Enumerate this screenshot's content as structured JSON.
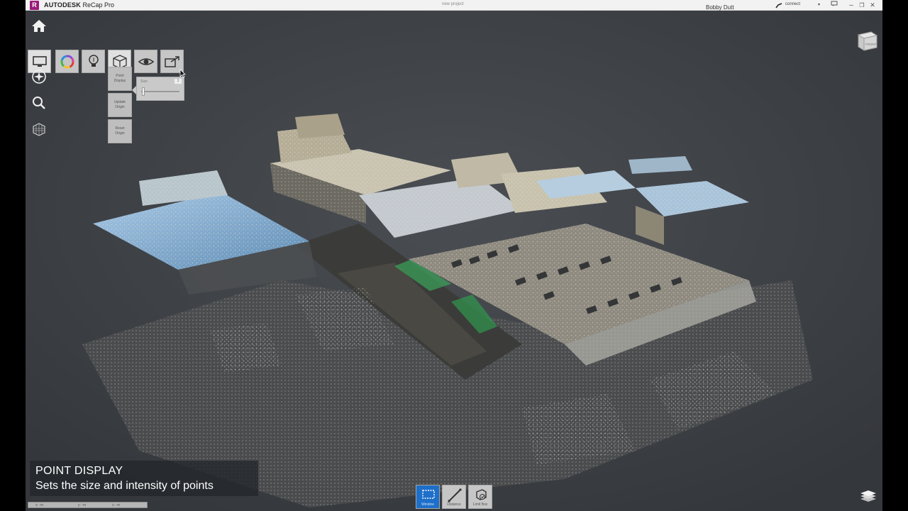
{
  "titlebar": {
    "logo_letter": "R",
    "brand": "AUTODESK",
    "product": "ReCap Pro",
    "project_name": "new project",
    "user_name": "Bobby Dutt",
    "connect_label": "connect",
    "minimize": "–",
    "restore": "❐",
    "close": "✕"
  },
  "toolbar": {
    "point_display_label": "Point\nDisplay",
    "update_origin_label": "Update\nOrigin",
    "reset_origin_label": "Reset\nOrigin",
    "size_label": "Size",
    "size_value": "1",
    "size_level": 0.05
  },
  "view_cube": {
    "face_label": "FRONT"
  },
  "caption": {
    "title": "POINT DISPLAY",
    "subtitle": "Sets the size and intensity of points"
  },
  "coords": {
    "x": "x: -m",
    "y": "y: -m",
    "z": "z: -m"
  },
  "bottom_tools": {
    "window": "Window",
    "distance": "Distance",
    "limit_box": "Limit Box"
  },
  "colors": {
    "accent": "#1e6fc9",
    "logo": "#9b1b7a",
    "background": "#3a3e43"
  }
}
